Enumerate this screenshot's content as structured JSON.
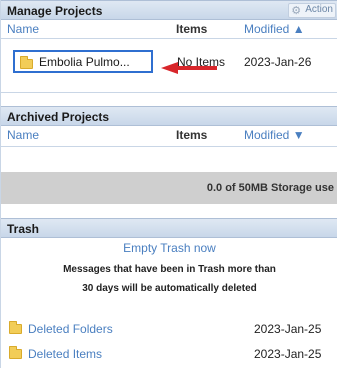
{
  "manage_projects": {
    "title": "Manage Projects",
    "actions_label": "Action",
    "columns": {
      "name": "Name",
      "items": "Items",
      "modified": "Modified ▲"
    },
    "project": {
      "name": "Embolia Pulmo...",
      "items": "No Items",
      "modified": "2023-Jan-26"
    }
  },
  "archived_projects": {
    "title": "Archived Projects",
    "columns": {
      "name": "Name",
      "items": "Items",
      "modified": "Modified ▼"
    }
  },
  "storage": {
    "text": "0.0 of 50MB Storage use",
    "used_fraction": 0.0
  },
  "trash": {
    "title": "Trash",
    "empty_link": "Empty Trash now",
    "message_line1": "Messages that have been in Trash more than",
    "message_line2": "30 days will be automatically deleted",
    "items": [
      {
        "name": "Deleted Folders",
        "date": "2023-Jan-25"
      },
      {
        "name": "Deleted Items",
        "date": "2023-Jan-25"
      }
    ]
  },
  "colors": {
    "link": "#4a7fc0",
    "highlight": "#2f6fd0",
    "annotation_arrow": "#d8262b",
    "folder": "#f2cd58"
  }
}
